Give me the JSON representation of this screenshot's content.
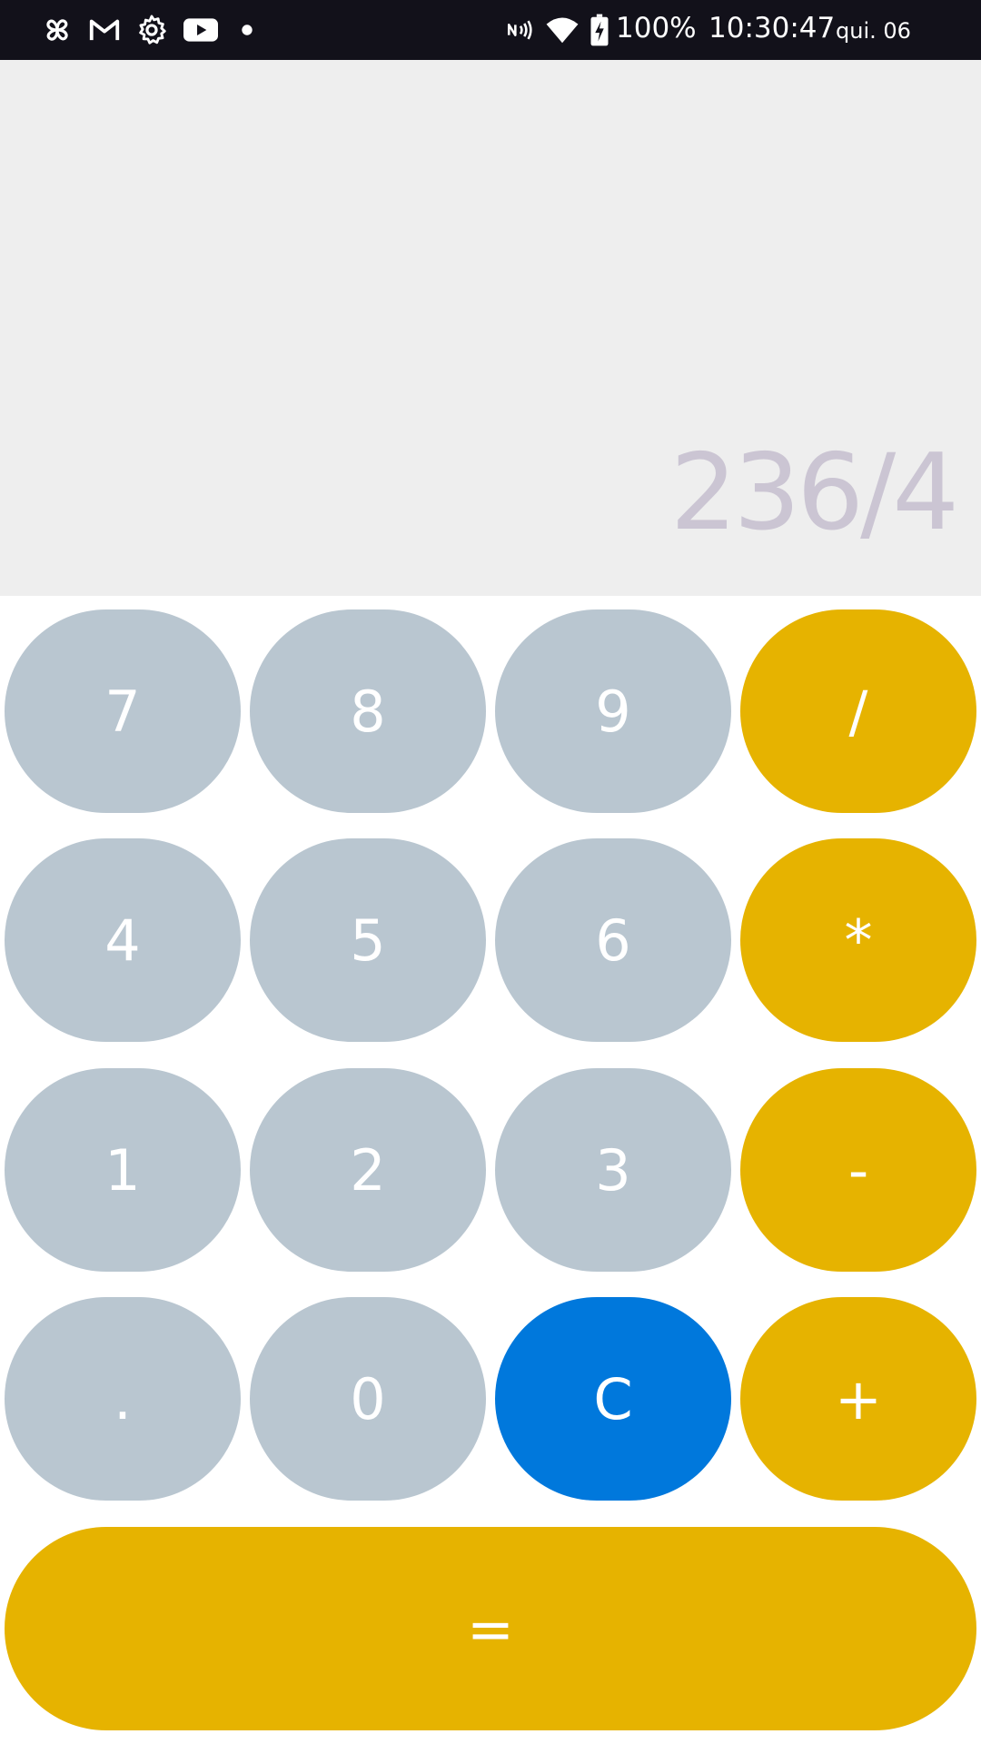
{
  "status_bar": {
    "icons_left": [
      "pinwheel-icon",
      "gmail-icon",
      "settings-icon",
      "youtube-icon",
      "dot-icon"
    ],
    "icons_right": [
      "nfc-icon",
      "wifi-icon",
      "battery-charging-icon"
    ],
    "battery": "100%",
    "time": "10:30:47",
    "date": "qui. 06"
  },
  "display": {
    "expression": "236/4"
  },
  "keypad": {
    "k7": "7",
    "k8": "8",
    "k9": "9",
    "div": "/",
    "k4": "4",
    "k5": "5",
    "k6": "6",
    "mul": "*",
    "k1": "1",
    "k2": "2",
    "k3": "3",
    "sub": "-",
    "dot": ".",
    "k0": "0",
    "clear": "C",
    "add": "+",
    "equals": "="
  },
  "colors": {
    "number_key": "#b9c6d0",
    "operator_key": "#e6b300",
    "clear_key": "#0078dc",
    "display_bg": "#eeeeee",
    "expression_text": "#cbc5d3",
    "status_bar_bg": "#12111a"
  }
}
